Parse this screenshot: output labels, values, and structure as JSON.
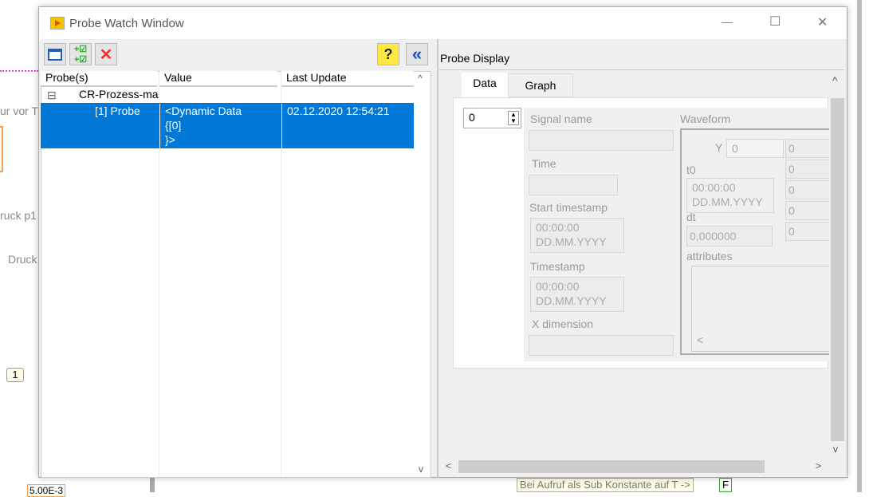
{
  "background": {
    "labels": [
      "ur vor T",
      "ruck p1",
      "Druck",
      "1",
      "Bei Aufruf als Sub Konstante auf T ->",
      "F",
      "5.00E-3"
    ]
  },
  "window": {
    "title": "Probe Watch Window",
    "minimize": "—",
    "maximize": "☐",
    "close": "✕"
  },
  "toolbar": {
    "new_icon": "new-window-icon",
    "select_icon": "add-checked-icon",
    "delete_icon": "✕",
    "help_icon": "?",
    "collapse_icon": "«"
  },
  "tree": {
    "columns": [
      "Probe(s)",
      "Value",
      "Last Update"
    ],
    "group": {
      "toggle": "⊟",
      "label": "CR-Prozess-ma"
    },
    "rows": [
      {
        "probe": "[1] Probe",
        "value": "<Dynamic Data\n{[0]\n}>",
        "updated": "02.12.2020 12:54:21"
      }
    ]
  },
  "display": {
    "title": "Probe Display",
    "tabs": [
      "Data",
      "Graph"
    ],
    "index": "0",
    "signal_name": "Signal name",
    "time": "Time",
    "start_timestamp": "Start timestamp",
    "start_value": "00:00:00\nDD.MM.YYYY",
    "timestamp": "Timestamp",
    "timestamp_value": "00:00:00\nDD.MM.YYYY",
    "x_dimension": "X dimension",
    "waveform": "Waveform",
    "y": "Y",
    "y_index": "0",
    "y_values": [
      "0",
      "0",
      "0",
      "0",
      "0"
    ],
    "t0": "t0",
    "t0_value": "00:00:00\nDD.MM.YYYY",
    "dt": "dt",
    "dt_value": "0,000000",
    "attributes": "attributes"
  },
  "scroll": {
    "up": "^",
    "down": "v",
    "left": "<",
    "right": ">"
  },
  "colors": {
    "selection": "#0078d7",
    "accent": "#1b4fbf"
  }
}
